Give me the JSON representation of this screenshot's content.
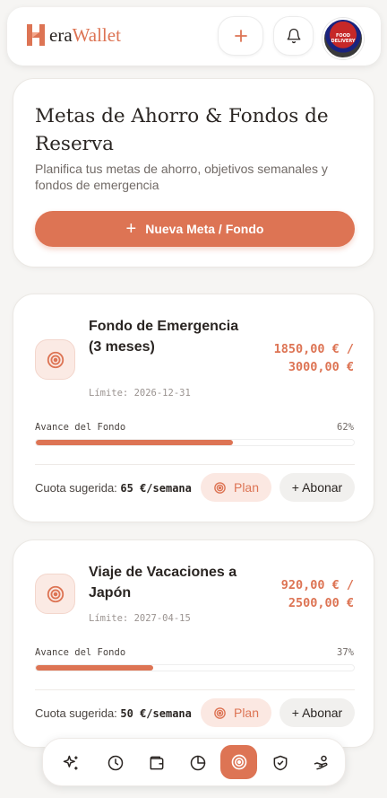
{
  "app": {
    "logo_letter": "H",
    "logo_text_dark": "era",
    "logo_text_accent": "Wallet",
    "avatar_lines": [
      "FOOD",
      "DELIVERY"
    ]
  },
  "colors": {
    "accent": "#dd7454",
    "accent_soft": "#fbe8e2",
    "background": "#f6f5f3"
  },
  "header_icons": [
    "plus-icon",
    "bell-icon"
  ],
  "hero": {
    "title": "Metas de Ahorro & Fondos de Reserva",
    "subtitle": "Planifica tus metas de ahorro, objetivos semanales y fondos de emergencia",
    "button_plus": "+",
    "button_label": "Nueva Meta / Fondo"
  },
  "goals": [
    {
      "title": "Fondo de Emergencia (3 meses)",
      "limit": "Límite: 2026-12-31",
      "amount_line1": "1850,00 € /",
      "amount_line2": "3000,00 €",
      "progress_label": "Avance del Fondo",
      "progress_pct_text": "62%",
      "progress": 0.62,
      "quota_label": "Cuota sugerida:",
      "quota_value": "65 €/semana",
      "plan_label": "Plan",
      "abonar_label": "+ Abonar"
    },
    {
      "title": "Viaje de Vacaciones a Japón",
      "limit": "Límite: 2027-04-15",
      "amount_line1": "920,00 € /",
      "amount_line2": "2500,00 €",
      "progress_label": "Avance del Fondo",
      "progress_pct_text": "37%",
      "progress": 0.37,
      "quota_label": "Cuota sugerida:",
      "quota_value": "50 €/semana",
      "plan_label": "Plan",
      "abonar_label": "+ Abonar"
    }
  ],
  "nav": {
    "items": [
      "sparkles-icon",
      "history-icon",
      "wallet-icon",
      "pie-chart-icon",
      "target-icon",
      "shield-icon",
      "hand-coins-icon"
    ],
    "active_index": 4
  }
}
